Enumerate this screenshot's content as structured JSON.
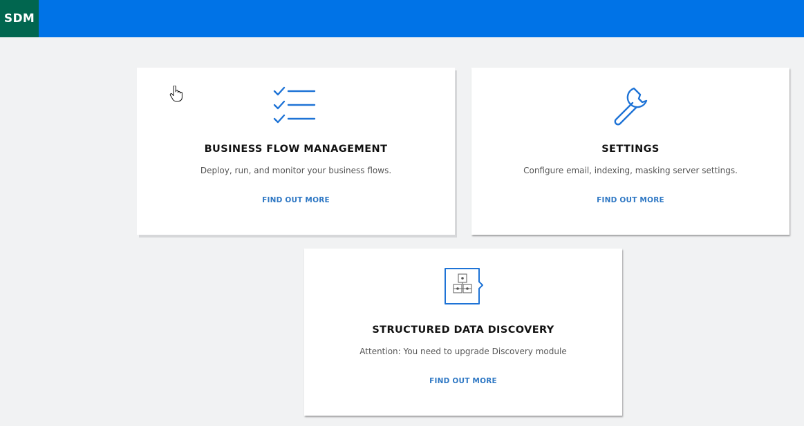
{
  "app": {
    "logo_text": "SDM",
    "colors": {
      "header": "#0073e7",
      "logo_bg": "#01664f",
      "accent": "#2f78c4",
      "icon": "#1e73d6"
    }
  },
  "cards": [
    {
      "icon": "checklist-icon",
      "title": "BUSINESS FLOW MANAGEMENT",
      "description": "Deploy, run, and monitor your business flows.",
      "link": "FIND OUT MORE"
    },
    {
      "icon": "wrench-icon",
      "title": "SETTINGS",
      "description": "Configure email, indexing, masking server settings.",
      "link": "FIND OUT MORE"
    },
    {
      "icon": "structured-data-icon",
      "title": "STRUCTURED DATA DISCOVERY",
      "description": "Attention: You need to upgrade Discovery module",
      "link": "FIND OUT MORE"
    }
  ]
}
